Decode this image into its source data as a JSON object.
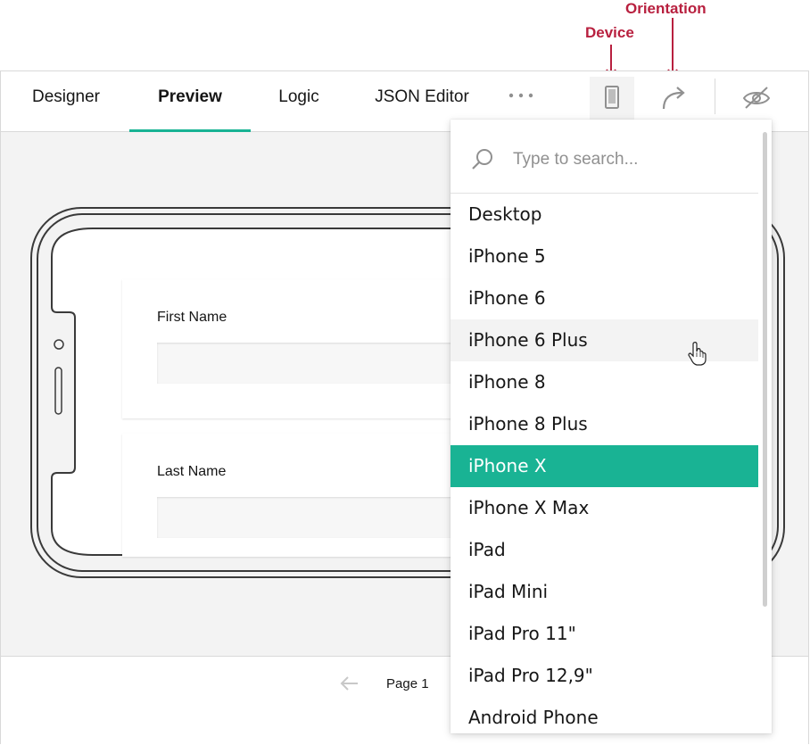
{
  "annotations": {
    "device_label": "Device",
    "orientation_label": "Orientation"
  },
  "tabs": [
    {
      "label": "Designer",
      "active": false
    },
    {
      "label": "Preview",
      "active": true
    },
    {
      "label": "Logic",
      "active": false
    },
    {
      "label": "JSON Editor",
      "active": false
    }
  ],
  "toolbar": {
    "more_icon": "more-horizontal-icon",
    "device_icon": "mobile-device-icon",
    "orientation_icon": "rotate-arrow-icon",
    "hide_icon": "eye-off-icon"
  },
  "survey": {
    "questions": [
      {
        "title": "First Name",
        "value": ""
      },
      {
        "title": "Last Name",
        "value": ""
      }
    ]
  },
  "footer": {
    "page_label": "Page 1",
    "prev_icon": "arrow-left-icon"
  },
  "device_dropdown": {
    "search_placeholder": "Type to search...",
    "hovered": "iPhone 6 Plus",
    "selected": "iPhone X",
    "items": [
      "Desktop",
      "iPhone 5",
      "iPhone 6",
      "iPhone 6 Plus",
      "iPhone 8",
      "iPhone 8 Plus",
      "iPhone X",
      "iPhone X Max",
      "iPad",
      "iPad Mini",
      "iPad Pro 11\"",
      "iPad Pro 12,9\"",
      "Android Phone"
    ]
  },
  "colors": {
    "accent": "#19b394",
    "annotation": "#b8203f"
  }
}
